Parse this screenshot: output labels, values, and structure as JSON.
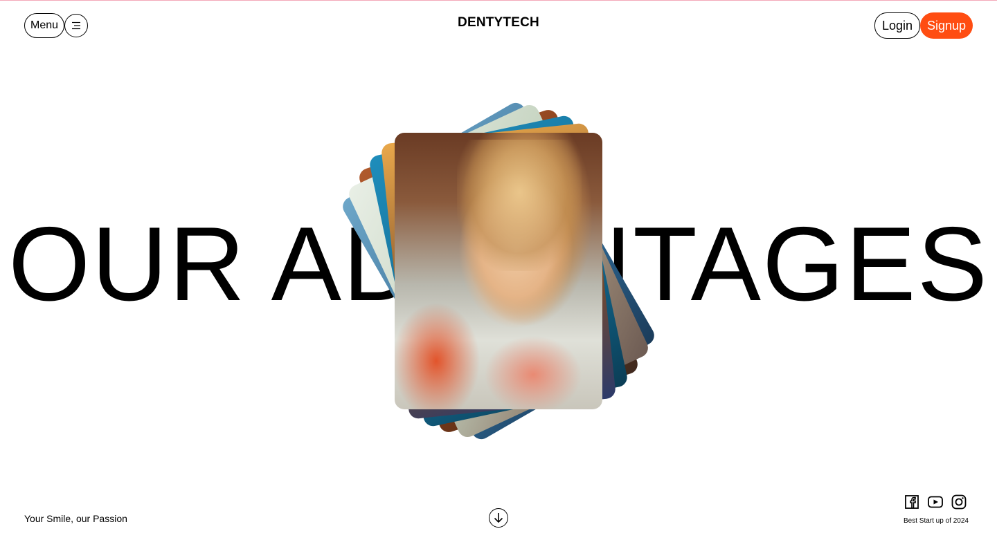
{
  "header": {
    "menu_label": "Menu",
    "brand": "DENTYTECH",
    "login_label": "Login",
    "signup_label": "Signup"
  },
  "hero": {
    "title": "OUR ADVANTAGES"
  },
  "footer": {
    "tagline": "Your Smile, our Passion",
    "award": "Best Start up of 2024",
    "social_icons": [
      "facebook-icon",
      "youtube-icon",
      "instagram-icon"
    ]
  },
  "colors": {
    "accent": "#ff4d12",
    "top_border": "#f3a7b8",
    "text": "#000000"
  },
  "icons": {
    "menu": "hamburger-icon",
    "scroll": "arrow-down-icon"
  }
}
